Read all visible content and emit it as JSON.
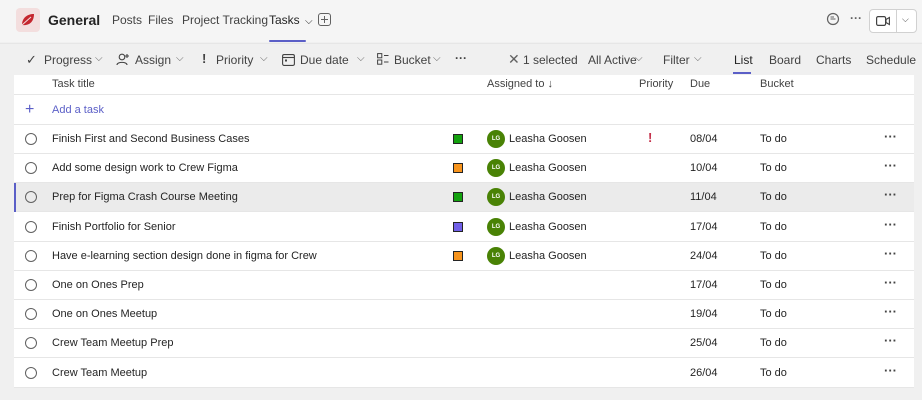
{
  "header": {
    "channel": "General",
    "tabs": [
      "Posts",
      "Files",
      "Project Tracking",
      "Tasks"
    ],
    "tasks_chevron": "⌵"
  },
  "toolbar": {
    "progress": "Progress",
    "assign": "Assign",
    "priority": "Priority",
    "due_date": "Due date",
    "bucket": "Bucket",
    "more": "···",
    "selected": "1 selected",
    "all_active": "All Active",
    "filter": "Filter",
    "views": [
      "List",
      "Board",
      "Charts",
      "Schedule"
    ]
  },
  "columns": {
    "title": "Task title",
    "assigned": "Assigned to ↓",
    "priority": "Priority",
    "due": "Due",
    "bucket": "Bucket"
  },
  "add_task": "Add a task",
  "rows": [
    {
      "title": "Finish First and Second Business Cases",
      "label_color": "#13a10e",
      "initials": "LG",
      "assignee": "Leasha Goosen",
      "priority": "!",
      "due": "08/04",
      "bucket": "To do",
      "more": "···"
    },
    {
      "title": "Add some design work to Crew Figma",
      "label_color": "#f7941d",
      "initials": "LG",
      "assignee": "Leasha Goosen",
      "priority": "",
      "due": "10/04",
      "bucket": "To do",
      "more": "···"
    },
    {
      "title": "Prep for Figma Crash Course Meeting",
      "label_color": "#13a10e",
      "initials": "LG",
      "assignee": "Leasha Goosen",
      "priority": "",
      "due": "11/04",
      "bucket": "To do",
      "more": "···",
      "selected": true
    },
    {
      "title": "Finish Portfolio for Senior",
      "label_color": "#7160e8",
      "initials": "LG",
      "assignee": "Leasha Goosen",
      "priority": "",
      "due": "17/04",
      "bucket": "To do",
      "more": "···"
    },
    {
      "title": "Have e-learning section design done in figma for Crew",
      "label_color": "#f7941d",
      "initials": "LG",
      "assignee": "Leasha Goosen",
      "priority": "",
      "due": "24/04",
      "bucket": "To do",
      "more": "···"
    },
    {
      "title": "One on Ones Prep",
      "label_color": "",
      "initials": "",
      "assignee": "",
      "priority": "",
      "due": "17/04",
      "bucket": "To do",
      "more": "···"
    },
    {
      "title": "One on Ones Meetup",
      "label_color": "",
      "initials": "",
      "assignee": "",
      "priority": "",
      "due": "19/04",
      "bucket": "To do",
      "more": "···"
    },
    {
      "title": "Crew Team Meetup Prep",
      "label_color": "",
      "initials": "",
      "assignee": "",
      "priority": "",
      "due": "25/04",
      "bucket": "To do",
      "more": "···"
    },
    {
      "title": "Crew Team Meetup",
      "label_color": "",
      "initials": "",
      "assignee": "",
      "priority": "",
      "due": "26/04",
      "bucket": "To do",
      "more": "···"
    }
  ]
}
